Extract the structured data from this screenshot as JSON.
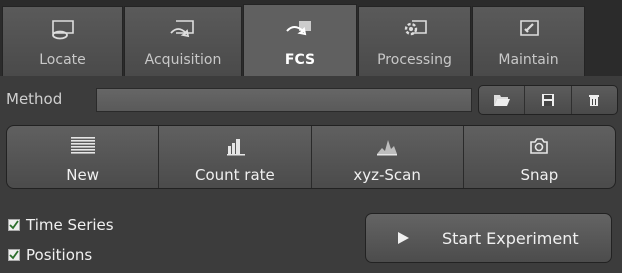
{
  "tabs": [
    {
      "label": "Locate",
      "icon": "locate-icon",
      "active": false
    },
    {
      "label": "Acquisition",
      "icon": "acquisition-icon",
      "active": false
    },
    {
      "label": "FCS",
      "icon": "fcs-icon",
      "active": true
    },
    {
      "label": "Processing",
      "icon": "processing-icon",
      "active": false
    },
    {
      "label": "Maintain",
      "icon": "maintain-icon",
      "active": false
    }
  ],
  "method": {
    "label": "Method",
    "value": "",
    "buttons": [
      {
        "icon": "folder-open-icon"
      },
      {
        "icon": "save-icon"
      },
      {
        "icon": "trash-icon"
      }
    ]
  },
  "actions": [
    {
      "label": "New",
      "icon": "new-lines-icon"
    },
    {
      "label": "Count rate",
      "icon": "bar-chart-icon"
    },
    {
      "label": "xyz-Scan",
      "icon": "scan-peak-icon"
    },
    {
      "label": "Snap",
      "icon": "camera-icon"
    }
  ],
  "options": [
    {
      "label": "Time Series",
      "checked": true
    },
    {
      "label": "Positions",
      "checked": true
    }
  ],
  "start": {
    "label": "Start Experiment",
    "icon": "play-icon"
  }
}
